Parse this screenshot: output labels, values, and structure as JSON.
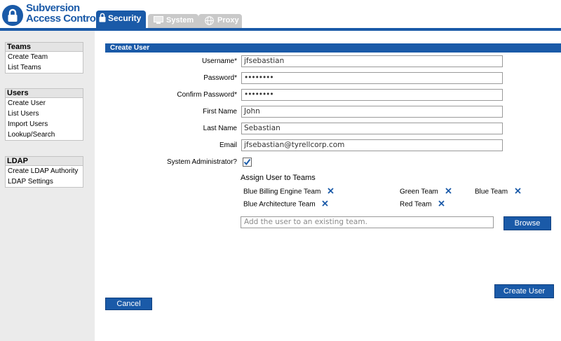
{
  "app": {
    "logo_line1": "Subversion",
    "logo_line2": "Access Control"
  },
  "tabs": [
    {
      "label": "Security",
      "active": true,
      "icon": "lock-icon"
    },
    {
      "label": "System",
      "active": false,
      "icon": "computer-icon"
    },
    {
      "label": "Proxy",
      "active": false,
      "icon": "globe-icon"
    }
  ],
  "sidebar": {
    "teams": {
      "heading": "Teams",
      "items": [
        "Create Team",
        "List Teams"
      ]
    },
    "users": {
      "heading": "Users",
      "items": [
        "Create User",
        "List Users",
        "Import Users",
        "Lookup/Search"
      ]
    },
    "ldap": {
      "heading": "LDAP",
      "items": [
        "Create LDAP Authority",
        "LDAP Settings"
      ]
    }
  },
  "form": {
    "title": "Create User",
    "username_label": "Username",
    "username_value": "jfsebastian",
    "password_label": "Password",
    "password_value": "••••••••",
    "confirm_label": "Confirm Password",
    "confirm_value": "••••••••",
    "firstname_label": "First Name",
    "firstname_value": "John",
    "lastname_label": "Last Name",
    "lastname_value": "Sebastian",
    "email_label": "Email",
    "email_value": "jfsebastian@tyrellcorp.com",
    "sysadmin_label": "System Administrator?",
    "sysadmin_checked": true,
    "required_mark": "*"
  },
  "teams_section": {
    "title": "Assign User to Teams",
    "teams": [
      "Blue Billing Engine Team",
      "Green Team",
      "Blue Team",
      "Blue Architecture Team",
      "Red Team"
    ],
    "input_placeholder": "Add the user to an existing team.",
    "browse_label": "Browse"
  },
  "actions": {
    "create_label": "Create User",
    "cancel_label": "Cancel"
  },
  "colors": {
    "accent": "#1a5aa8",
    "inactive_tab": "#c9c9c9",
    "sidebar_bg": "#ebebeb"
  }
}
